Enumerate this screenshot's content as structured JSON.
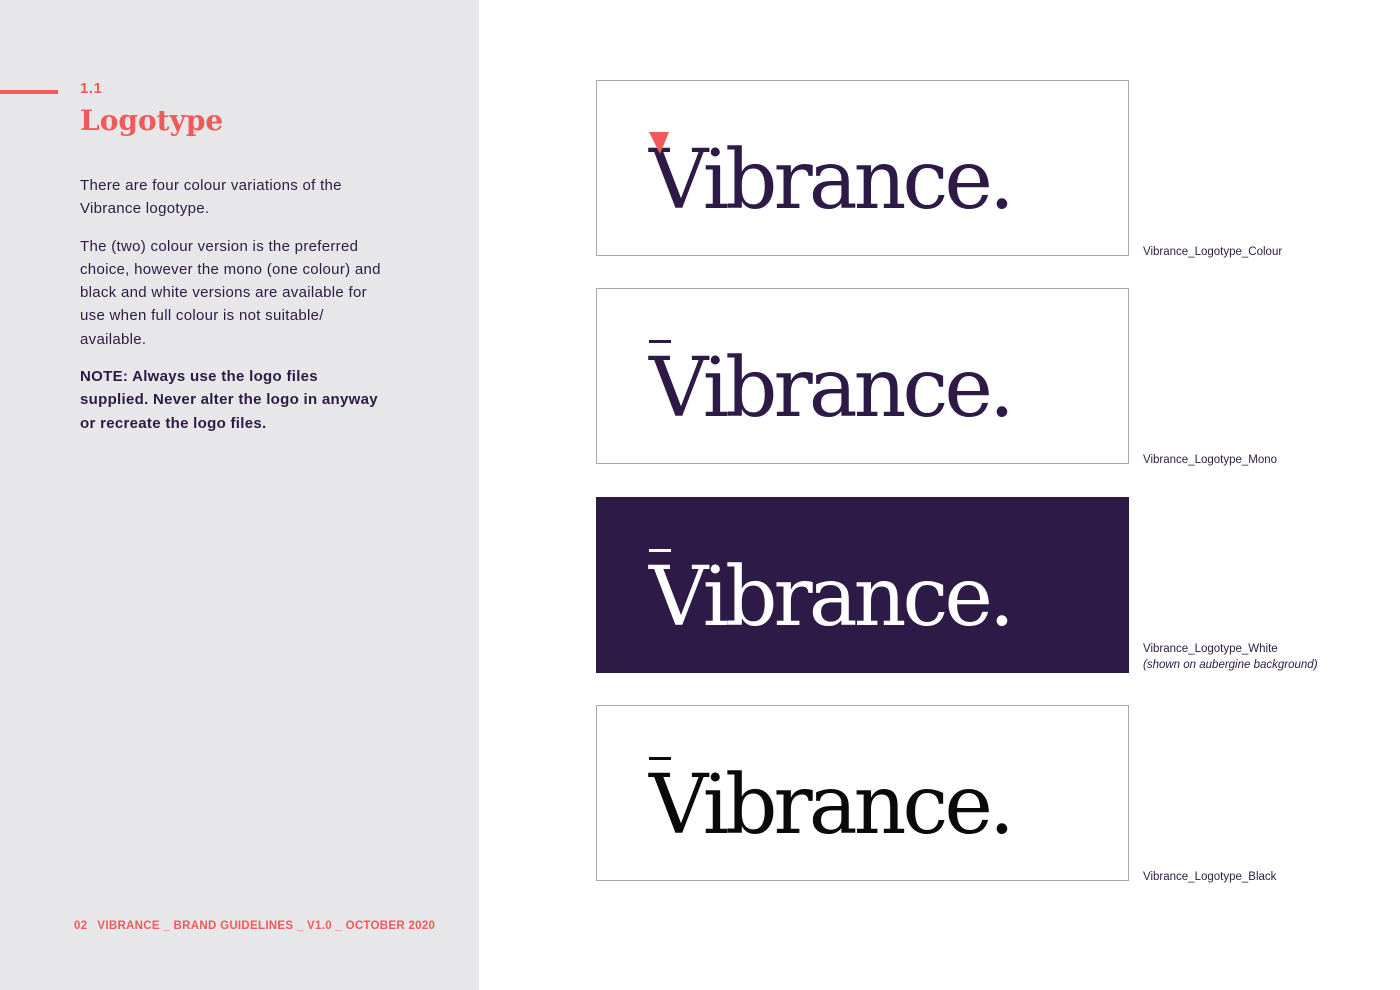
{
  "colors": {
    "coral": "#f05a5b",
    "aubergine": "#2e1a46",
    "black": "#0a0a0a",
    "white": "#ffffff",
    "sidebar_bg": "#e7e6e8"
  },
  "section": {
    "number": "1.1",
    "title": "Logotype"
  },
  "body": {
    "paragraph_1": "There are four colour variations of the Vibrance logotype.",
    "paragraph_2": "The (two) colour version is the preferred choice, however the mono (one colour) and black and white versions are available for use when full colour is not suitable/ available.",
    "note": "NOTE: Always use the logo files supplied. Never alter the logo in anyway or recreate the logo files."
  },
  "logos": [
    {
      "wordmark": "Vibrance.",
      "variant": "colour",
      "caption": "Vibrance_Logotype_Colour"
    },
    {
      "wordmark": "Vibrance.",
      "variant": "mono",
      "caption": "Vibrance_Logotype_Mono"
    },
    {
      "wordmark": "Vibrance.",
      "variant": "white",
      "caption": "Vibrance_Logotype_White",
      "caption_note": "(shown on aubergine background)"
    },
    {
      "wordmark": "Vibrance.",
      "variant": "black",
      "caption": "Vibrance_Logotype_Black"
    }
  ],
  "footer": {
    "page_number": "02",
    "text": "VIBRANCE _ BRAND GUIDELINES _ V1.0 _ OCTOBER 2020"
  }
}
